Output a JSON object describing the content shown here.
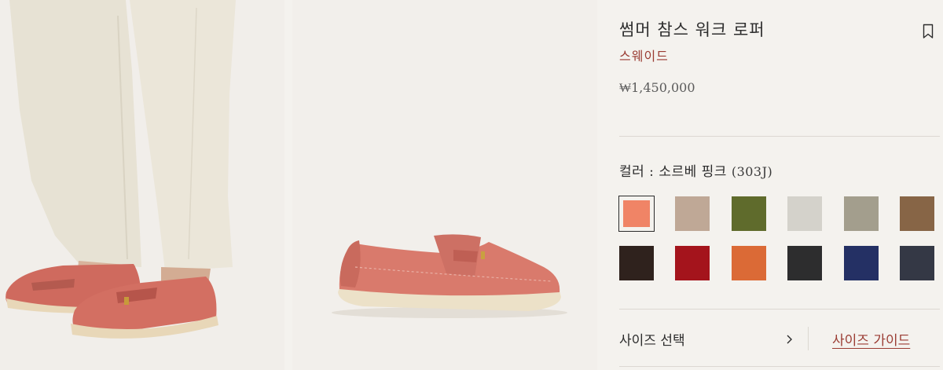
{
  "product": {
    "title": "썸머 참스 워크 로퍼",
    "material": "스웨이드",
    "price": "₩1,450,000"
  },
  "color": {
    "label": "컬러 : 소르베 핑크",
    "code": "(303J)",
    "swatches": [
      {
        "name": "sorbet-pink",
        "hex": "#f08466",
        "selected": true
      },
      {
        "name": "beige",
        "hex": "#bfa896",
        "selected": false
      },
      {
        "name": "olive",
        "hex": "#5f6b2c",
        "selected": false
      },
      {
        "name": "off-white",
        "hex": "#d4d2cb",
        "selected": false
      },
      {
        "name": "taupe",
        "hex": "#a39e8d",
        "selected": false
      },
      {
        "name": "tan",
        "hex": "#876546",
        "selected": false
      },
      {
        "name": "dark-brown",
        "hex": "#2f221d",
        "selected": false
      },
      {
        "name": "red",
        "hex": "#a4141c",
        "selected": false
      },
      {
        "name": "orange",
        "hex": "#db6a36",
        "selected": false
      },
      {
        "name": "charcoal",
        "hex": "#2d2d2e",
        "selected": false
      },
      {
        "name": "navy",
        "hex": "#243064",
        "selected": false
      },
      {
        "name": "slate",
        "hex": "#343845",
        "selected": false
      }
    ]
  },
  "size": {
    "select_label": "사이즈 선택",
    "guide_label": "사이즈 가이드"
  },
  "icons": {
    "bookmark": "bookmark-icon",
    "chevron": "chevron-right-icon"
  },
  "colors": {
    "accent": "#9a3b32",
    "background": "#f4f2ee"
  }
}
